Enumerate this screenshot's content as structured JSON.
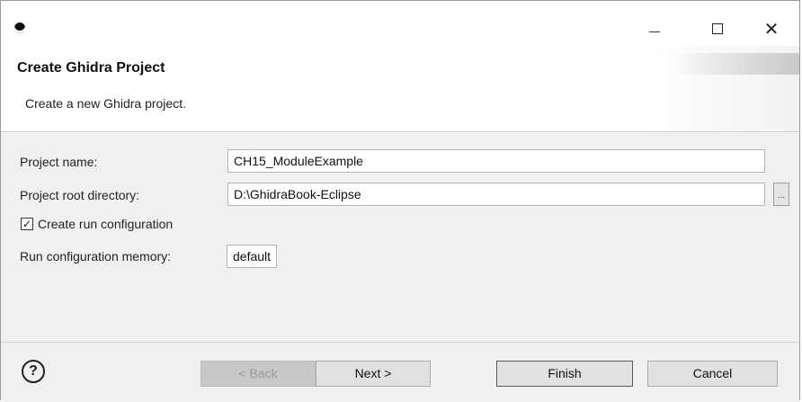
{
  "window": {
    "title_icon": "eclipse-icon",
    "controls": {
      "minimize": "—",
      "maximize": "☐",
      "close": "✕"
    }
  },
  "header": {
    "title": "Create Ghidra Project",
    "description": "Create a new Ghidra project."
  },
  "form": {
    "project_name_label": "Project name:",
    "project_name_value": "CH15_ModuleExample",
    "root_dir_label": "Project root directory:",
    "root_dir_value": "D:\\GhidraBook-Eclipse",
    "browse_label": "...",
    "run_config_label": "Create run configuration",
    "run_config_checked": true,
    "run_config_check_glyph": "✓",
    "memory_label": "Run configuration memory:",
    "memory_value": "default"
  },
  "footer": {
    "help_label": "?",
    "back_label": "< Back",
    "next_label": "Next >",
    "finish_label": "Finish",
    "cancel_label": "Cancel"
  }
}
